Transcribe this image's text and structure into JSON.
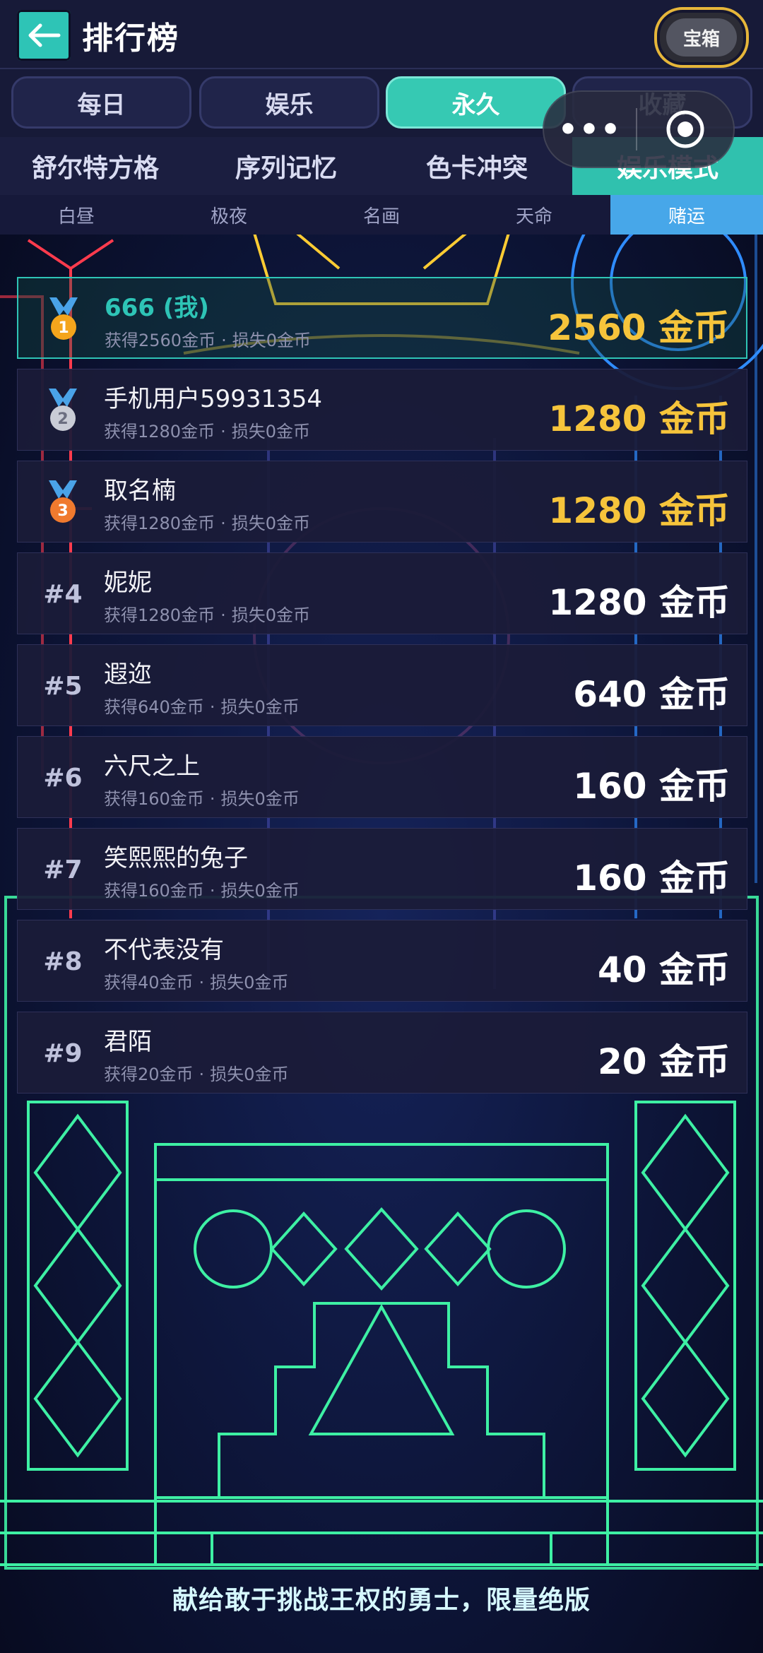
{
  "header": {
    "title": "排行榜",
    "chest_label": "宝箱"
  },
  "period_tabs": [
    {
      "label": "每日",
      "active": false
    },
    {
      "label": "娱乐",
      "active": false
    },
    {
      "label": "永久",
      "active": true
    },
    {
      "label": "收藏",
      "active": false
    }
  ],
  "modes": [
    {
      "label": "舒尔特方格",
      "active": false
    },
    {
      "label": "序列记忆",
      "active": false
    },
    {
      "label": "色卡冲突",
      "active": false
    },
    {
      "label": "娱乐模式",
      "active": true
    }
  ],
  "sub_tabs": [
    {
      "label": "白昼",
      "active": false
    },
    {
      "label": "极夜",
      "active": false
    },
    {
      "label": "名画",
      "active": false
    },
    {
      "label": "天命",
      "active": false
    },
    {
      "label": "赌运",
      "active": true
    }
  ],
  "leaderboard": [
    {
      "rank": "1",
      "name": "666 (我)",
      "gained": "获得2560金币",
      "lost": "损失0金币",
      "score": "2560 金币",
      "medal": "gold",
      "me": true
    },
    {
      "rank": "2",
      "name": "手机用户59931354",
      "gained": "获得1280金币",
      "lost": "损失0金币",
      "score": "1280 金币",
      "medal": "silver",
      "me": false
    },
    {
      "rank": "3",
      "name": "取名楠",
      "gained": "获得1280金币",
      "lost": "损失0金币",
      "score": "1280 金币",
      "medal": "bronze",
      "me": false
    },
    {
      "rank": "#4",
      "name": "妮妮",
      "gained": "获得1280金币",
      "lost": "损失0金币",
      "score": "1280 金币",
      "medal": "",
      "me": false
    },
    {
      "rank": "#5",
      "name": "遐迩",
      "gained": "获得640金币",
      "lost": "损失0金币",
      "score": "640 金币",
      "medal": "",
      "me": false
    },
    {
      "rank": "#6",
      "name": "六尺之上",
      "gained": "获得160金币",
      "lost": "损失0金币",
      "score": "160 金币",
      "medal": "",
      "me": false
    },
    {
      "rank": "#7",
      "name": "笑熙熙的兔子",
      "gained": "获得160金币",
      "lost": "损失0金币",
      "score": "160 金币",
      "medal": "",
      "me": false
    },
    {
      "rank": "#8",
      "name": "不代表没有",
      "gained": "获得40金币",
      "lost": "损失0金币",
      "score": "40 金币",
      "medal": "",
      "me": false
    },
    {
      "rank": "#9",
      "name": "君陌",
      "gained": "获得20金币",
      "lost": "损失0金币",
      "score": "20 金币",
      "medal": "",
      "me": false
    }
  ],
  "footer_text": "献给敢于挑战王权的勇士，限量绝版",
  "colors": {
    "accent": "#2ec4b6",
    "gold": "#f6c43b",
    "sub_active": "#47a7e9"
  }
}
